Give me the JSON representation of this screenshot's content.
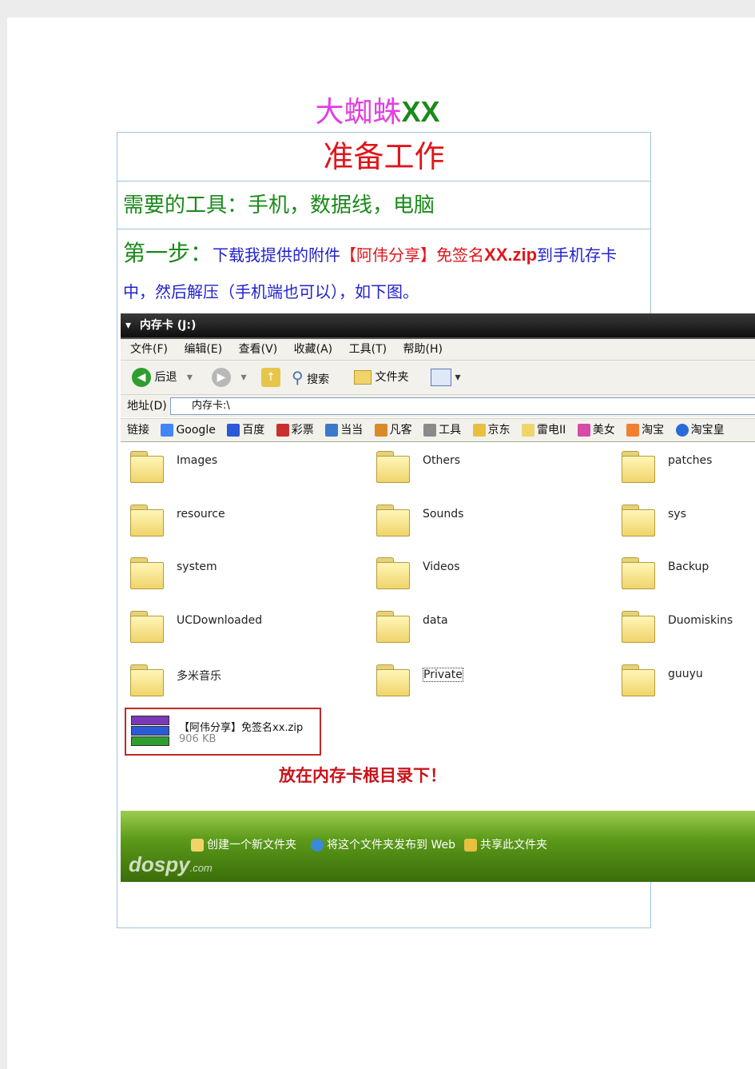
{
  "document": {
    "title_part1": "大蜘蛛",
    "title_part2": "XX",
    "section_title": "准备工作",
    "tools_line": "需要的工具：手机，数据线，电脑",
    "step": {
      "label": "第一步：",
      "text1": "下载我提供的附件",
      "attachment": "【阿伟分享】免签名",
      "file_bold": "XX.zip",
      "text2": "到手机存卡中，然后解压（手机端也可以），如下图。"
    }
  },
  "explorer": {
    "window_title": "内存卡 (J:)",
    "menu": [
      "文件(F)",
      "编辑(E)",
      "查看(V)",
      "收藏(A)",
      "工具(T)",
      "帮助(H)"
    ],
    "toolbar": {
      "back_label": "后退",
      "search_label": "搜索",
      "folders_label": "文件夹"
    },
    "address": {
      "label": "地址(D)",
      "value": "内存卡:\\"
    },
    "links": {
      "label": "链接",
      "items": [
        "Google",
        "百度",
        "彩票",
        "当当",
        "凡客",
        "工具",
        "京东",
        "雷电II",
        "美女",
        "淘宝",
        "淘宝皇"
      ]
    },
    "folders": [
      [
        "Images",
        "Others",
        "patches"
      ],
      [
        "resource",
        "Sounds",
        "sys"
      ],
      [
        "system",
        "Videos",
        "Backup"
      ],
      [
        "UCDownloaded",
        "data",
        "Duomiskins"
      ],
      [
        "多米音乐",
        "Private",
        "guuyu"
      ]
    ],
    "zip_file": {
      "name": "【阿伟分享】免签名xx.zip",
      "size": "906 KB"
    },
    "annotation": "放在内存卡根目录下！",
    "tasks": [
      "创建一个新文件夹",
      "将这个文件夹发布到 Web",
      "共享此文件夹"
    ],
    "watermark": "dospy",
    "watermark_suffix": ".com"
  }
}
